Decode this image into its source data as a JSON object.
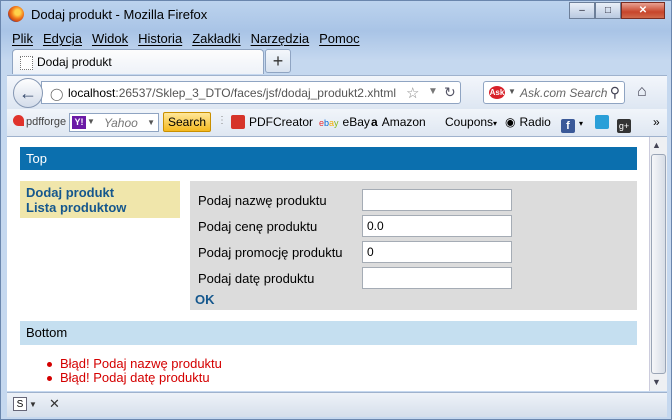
{
  "window": {
    "title": "Dodaj produkt - Mozilla Firefox",
    "buttons": {
      "minimize": "–",
      "maximize": "□",
      "close": "✕"
    }
  },
  "menu": [
    "Plik",
    "Edycja",
    "Widok",
    "Historia",
    "Zakładki",
    "Narzędzia",
    "Pomoc"
  ],
  "tab": {
    "label": "Dodaj produkt",
    "new_tab": "+"
  },
  "navbar": {
    "url_host": "localhost",
    "url_rest": ":26537/Sklep_3_DTO/faces/jsf/dodaj_produkt2.xhtml",
    "ask_placeholder": "Ask.com Search",
    "ask_logo": "Ask"
  },
  "toolbar": {
    "pdfforge": "pdfforge",
    "yahoo_placeholder": "Yahoo",
    "search_label": "Search",
    "items": [
      "PDFCreator",
      "eBay",
      "Amazon",
      "Coupons",
      "Radio"
    ]
  },
  "page": {
    "top": "Top",
    "menu": [
      "Dodaj produkt",
      "Lista produktow"
    ],
    "form": {
      "fields": [
        {
          "label": "Podaj nazwę produktu",
          "value": ""
        },
        {
          "label": "Podaj cenę produktu",
          "value": "0.0"
        },
        {
          "label": "Podaj promocję produktu",
          "value": "0"
        },
        {
          "label": "Podaj datę produktu",
          "value": ""
        }
      ],
      "ok": "OK"
    },
    "bottom": "Bottom",
    "errors": [
      "Błąd! Podaj nazwę produktu",
      "Błąd! Podaj datę produktu"
    ]
  },
  "colors": {
    "top_bar": "#0b6fae",
    "menu_bg": "#f0e6ab",
    "form_bg": "#dcdcdc",
    "bottom_bar": "#c5dff0",
    "error": "#d40000",
    "link": "#15578d"
  }
}
